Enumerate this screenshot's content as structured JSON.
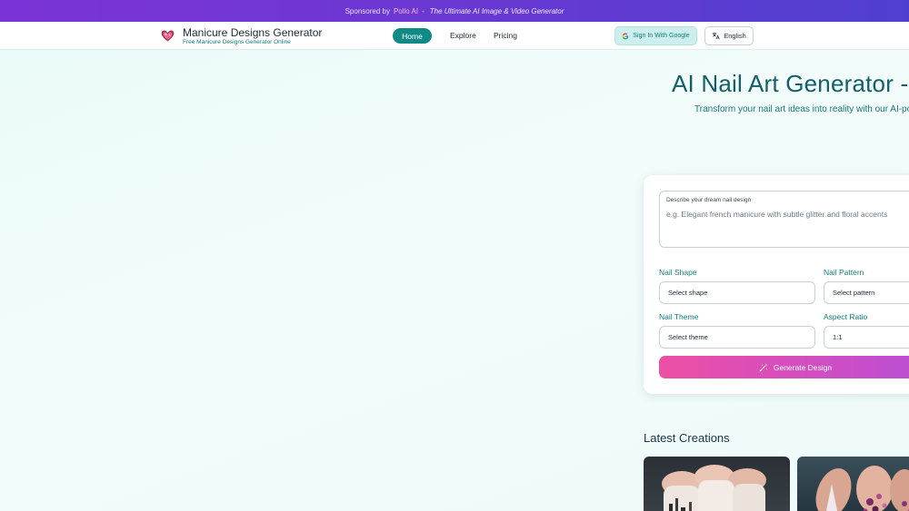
{
  "sponsor": {
    "prefix": "Sponsored by",
    "brand": "Pollo AI",
    "separator": "-",
    "tagline": "The Ultimate AI Image & Video Generator"
  },
  "header": {
    "logo_icon": "heart-nail-logo-icon",
    "title": "Manicure Designs Generator",
    "subtitle": "Free Manicure Designs Generator Online",
    "nav": {
      "home": "Home",
      "explore": "Explore",
      "pricing": "Pricing"
    },
    "signin_label": "Sign In With Google",
    "language_label": "English"
  },
  "hero": {
    "title": "AI Nail Art Generator - C",
    "subtitle": "Transform your nail art ideas into reality with our AI-power"
  },
  "form": {
    "prompt_label": "Describe your dream nail design",
    "prompt_placeholder": "e.g. Elegant french manicure with subtle glitter and floral accents",
    "shape_label": "Nail Shape",
    "shape_value": "Select shape",
    "pattern_label": "Nail Pattern",
    "pattern_value": "Select pattern",
    "theme_label": "Nail Theme",
    "theme_value": "Select theme",
    "ratio_label": "Aspect Ratio",
    "ratio_value": "1:1",
    "generate_label": "Generate Design"
  },
  "latest": {
    "title": "Latest Creations"
  },
  "colors": {
    "accent": "#0f8a86",
    "sponsor_bar": "#6a38d2",
    "generate_start": "#ec4fa4",
    "generate_end": "#b84fd6"
  }
}
